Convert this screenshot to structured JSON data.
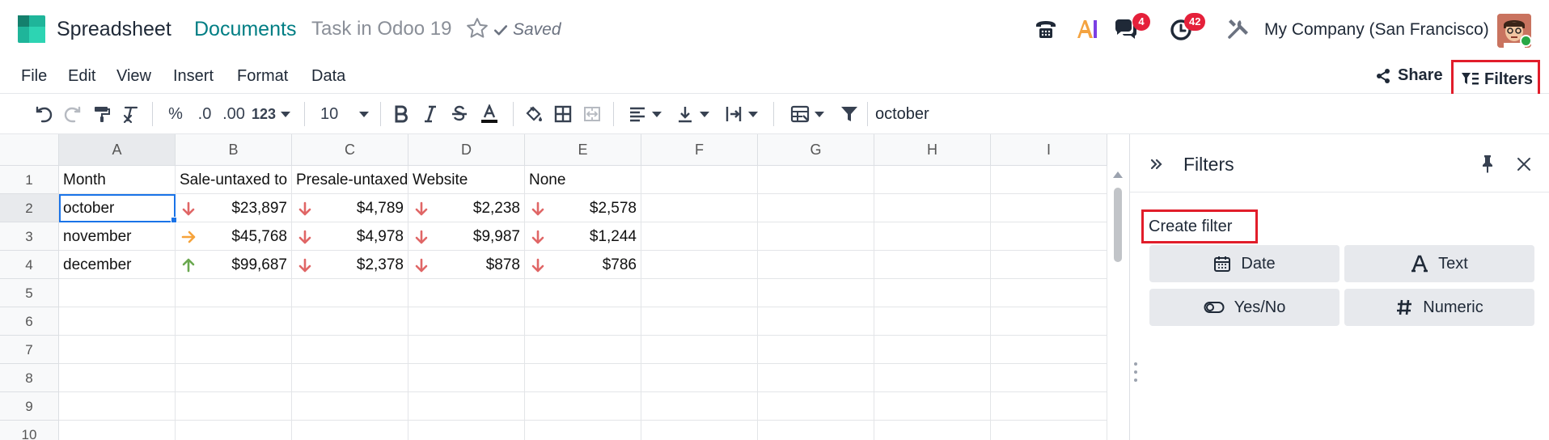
{
  "header": {
    "app_name": "Spreadsheet",
    "breadcrumb_documents": "Documents",
    "document_title": "Task in Odoo 19",
    "saved_label": "Saved",
    "messages_badge": "4",
    "activities_badge": "42",
    "company": "My Company (San Francisco)"
  },
  "menu": {
    "items": [
      "File",
      "Edit",
      "View",
      "Insert",
      "Format",
      "Data"
    ],
    "share_label": "Share",
    "filters_label": "Filters"
  },
  "toolbar": {
    "percent": "%",
    "dec_less": ".0",
    "dec_more": ".00",
    "num_format": "123",
    "font_size": "10",
    "formula_value": "october"
  },
  "grid": {
    "columns": [
      "A",
      "B",
      "C",
      "D",
      "E",
      "F",
      "G",
      "H",
      "I"
    ],
    "rows": [
      "1",
      "2",
      "3",
      "4",
      "5",
      "6",
      "7",
      "8",
      "9",
      "10"
    ],
    "header_row": [
      "Month",
      "Sale-untaxed to",
      "Presale-untaxed",
      "Website",
      "None"
    ],
    "data": [
      {
        "month": "october",
        "b": "$23,897",
        "b_trend": "down",
        "c": "$4,789",
        "c_trend": "down",
        "d": "$2,238",
        "d_trend": "down",
        "e": "$2,578",
        "e_trend": "down"
      },
      {
        "month": "november",
        "b": "$45,768",
        "b_trend": "flat",
        "c": "$4,978",
        "c_trend": "down",
        "d": "$9,987",
        "d_trend": "down",
        "e": "$1,244",
        "e_trend": "down"
      },
      {
        "month": "december",
        "b": "$99,687",
        "b_trend": "up",
        "c": "$2,378",
        "c_trend": "down",
        "d": "$878",
        "d_trend": "down",
        "e": "$786",
        "e_trend": "down"
      }
    ],
    "active_cell": "A2"
  },
  "panel": {
    "title": "Filters",
    "create_filter_label": "Create filter",
    "types": [
      "Date",
      "Text",
      "Yes/No",
      "Numeric"
    ]
  },
  "colors": {
    "accent_teal": "#017e84",
    "highlight_red": "#e11d2a",
    "arrow_down": "#e06666",
    "arrow_flat": "#f6a33b",
    "arrow_up": "#6aa84f",
    "selection_blue": "#1a73e8"
  }
}
